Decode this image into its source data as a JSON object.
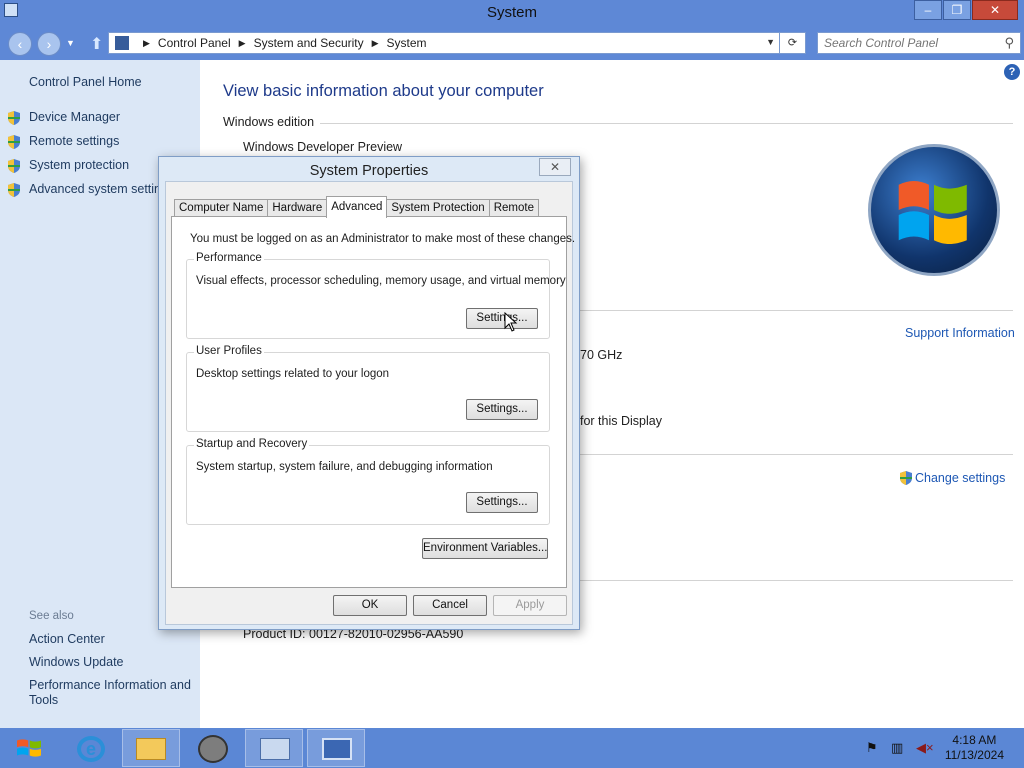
{
  "window": {
    "title": "System",
    "minimize": "–",
    "maximize": "❐",
    "close": "✕"
  },
  "address": {
    "back": "‹",
    "forward": "›",
    "breadcrumbs": [
      "Control Panel",
      "System and Security",
      "System"
    ],
    "separator": "▶",
    "refresh": "⟳",
    "search_placeholder": "Search Control Panel"
  },
  "sidebar": {
    "home": "Control Panel Home",
    "links": [
      "Device Manager",
      "Remote settings",
      "System protection",
      "Advanced system settings"
    ],
    "see_also_heading": "See also",
    "see_also": [
      "Action Center",
      "Windows Update",
      "Performance Information and Tools"
    ]
  },
  "main": {
    "title": "View basic information about your computer",
    "windows_edition_heading": "Windows edition",
    "edition": "Windows Developer Preview",
    "cpu_suffix": "70 GHz",
    "display_suffix": "for this Display",
    "support_link": "Support Information",
    "change_settings": "Change settings",
    "product_id": "Product ID: 00127-82010-02956-AA590",
    "help": "?"
  },
  "dialog": {
    "title": "System Properties",
    "close": "✕",
    "tabs": [
      "Computer Name",
      "Hardware",
      "Advanced",
      "System Protection",
      "Remote"
    ],
    "active_tab": "Advanced",
    "admin_note": "You must be logged on as an Administrator to make most of these changes.",
    "groups": [
      {
        "title": "Performance",
        "desc": "Visual effects, processor scheduling, memory usage, and virtual memory",
        "button": "Settings..."
      },
      {
        "title": "User Profiles",
        "desc": "Desktop settings related to your logon",
        "button": "Settings..."
      },
      {
        "title": "Startup and Recovery",
        "desc": "System startup, system failure, and debugging information",
        "button": "Settings..."
      }
    ],
    "env_button": "Environment Variables...",
    "ok": "OK",
    "cancel": "Cancel",
    "apply": "Apply"
  },
  "taskbar": {
    "time": "4:18 AM",
    "date": "11/13/2024"
  },
  "colors": {
    "titlebar": "#5e88d6",
    "sidebar": "#dbe7f6",
    "link": "#1e58b4",
    "taskbar": "#5b87d5"
  }
}
